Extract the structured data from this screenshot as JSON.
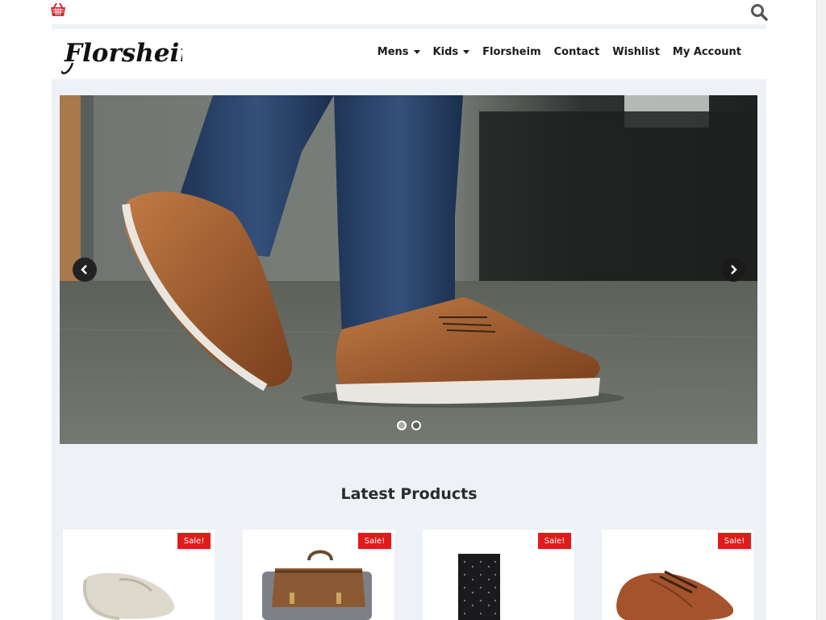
{
  "topbar": {
    "basket_icon": "basket-icon",
    "search_icon": "search-icon"
  },
  "brand": {
    "logo_text": "Florsheim"
  },
  "nav": {
    "items": [
      {
        "label": "Mens",
        "has_dropdown": true
      },
      {
        "label": "Kids",
        "has_dropdown": true
      },
      {
        "label": "Florsheim",
        "has_dropdown": false
      },
      {
        "label": "Contact",
        "has_dropdown": false
      },
      {
        "label": "Wishlist",
        "has_dropdown": false
      },
      {
        "label": "My Account",
        "has_dropdown": false
      }
    ]
  },
  "slider": {
    "slide_count": 2,
    "active_index": 0
  },
  "latest": {
    "title": "Latest Products",
    "products": [
      {
        "badge": "Sale!",
        "image": "white loafer"
      },
      {
        "badge": "Sale!",
        "image": "canvas leather backpack"
      },
      {
        "badge": "Sale!",
        "image": "black dotted sock"
      },
      {
        "badge": "Sale!",
        "image": "brown wingtip oxford"
      }
    ]
  },
  "colors": {
    "sale_badge": "#e11b1b",
    "content_bg": "#eef2f6",
    "accent": "#cc1f2f"
  }
}
